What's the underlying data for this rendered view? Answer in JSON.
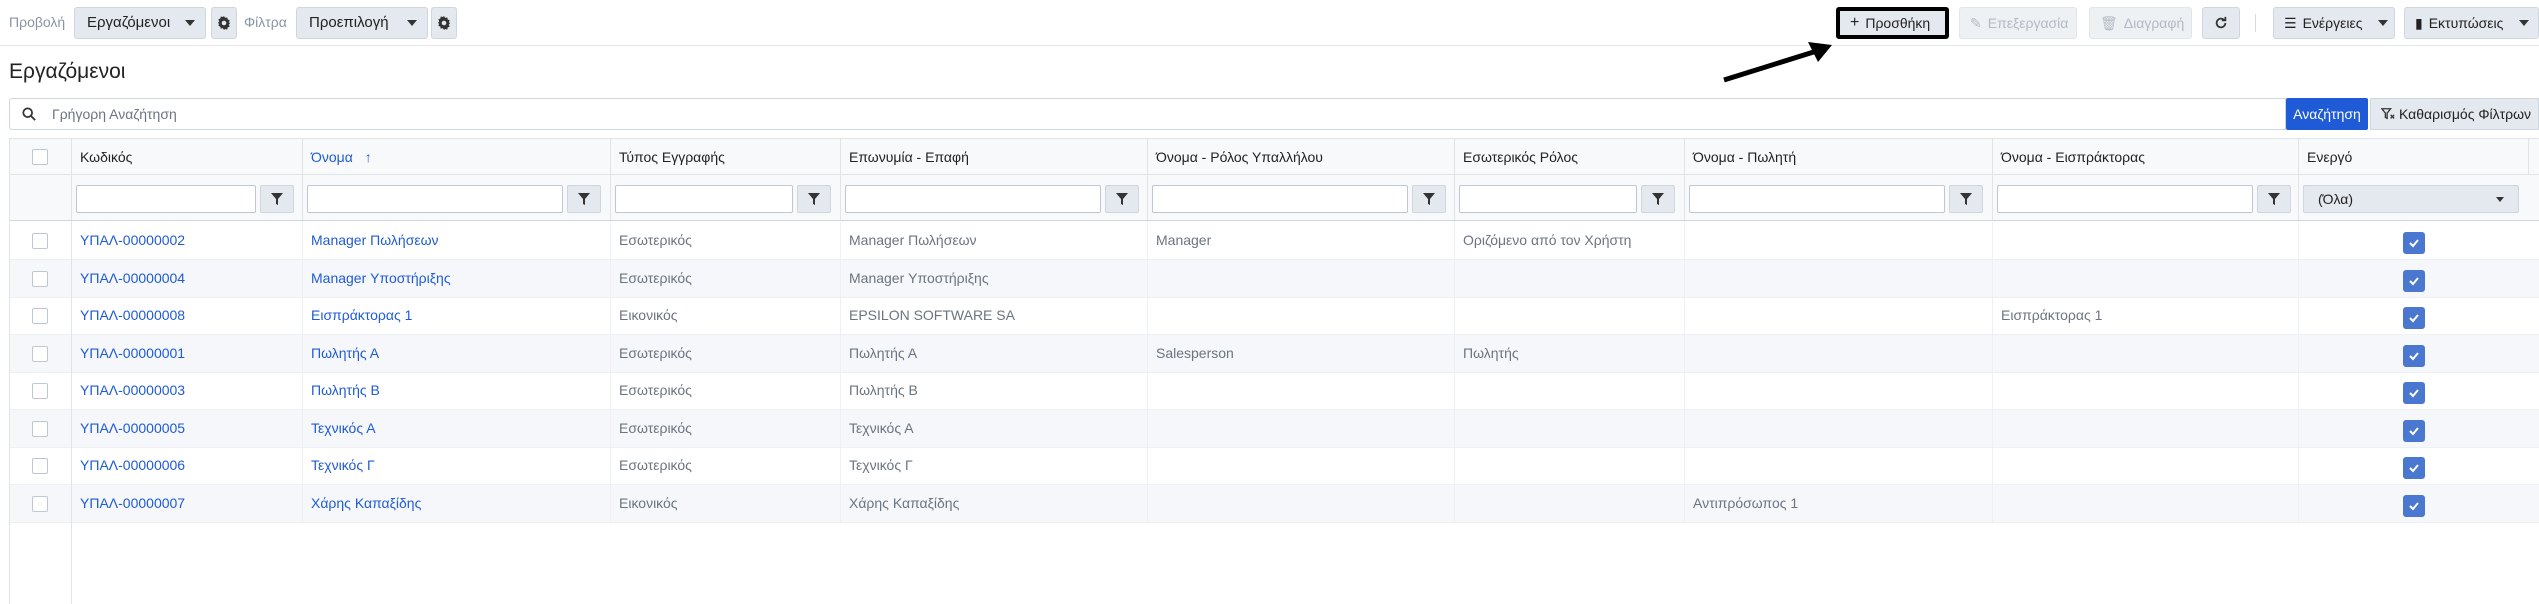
{
  "toolbar": {
    "view_label": "Προβολή",
    "view_value": "Εργαζόμενοι",
    "filter_label": "Φίλτρα",
    "filter_value": "Προεπιλογή",
    "add_label": "Προσθήκη",
    "edit_label": "Επεξεργασία",
    "delete_label": "Διαγραφή",
    "actions_label": "Ενέργειες",
    "prints_label": "Εκτυπώσεις"
  },
  "page_title": "Εργαζόμενοι",
  "search": {
    "placeholder": "Γρήγορη Αναζήτηση",
    "search_button": "Αναζήτηση",
    "clear_button": "Καθαρισμός Φίλτρων"
  },
  "columns": [
    {
      "label": "Κωδικός"
    },
    {
      "label": "Όνομα",
      "sorted": "asc"
    },
    {
      "label": "Τύπος Εγγραφής"
    },
    {
      "label": "Επωνυμία - Επαφή"
    },
    {
      "label": "Όνομα - Ρόλος Υπαλλήλου"
    },
    {
      "label": "Εσωτερικός Ρόλος"
    },
    {
      "label": "Όνομα - Πωλητή"
    },
    {
      "label": "Όνομα - Εισπράκτορας"
    },
    {
      "label": "Ενεργό"
    }
  ],
  "active_filter_value": "(Όλα)",
  "rows": [
    {
      "code": "ΥΠΑΛ-00000002",
      "name": "Manager Πωλήσεων",
      "type": "Εσωτερικός",
      "contact": "Manager Πωλήσεων",
      "role": "Manager",
      "internal_role": "Οριζόμενο από τον Χρήστη",
      "seller": "",
      "collector": "",
      "active": true
    },
    {
      "code": "ΥΠΑΛ-00000004",
      "name": "Manager Υποστήριξης",
      "type": "Εσωτερικός",
      "contact": "Manager Υποστήριξης",
      "role": "",
      "internal_role": "",
      "seller": "",
      "collector": "",
      "active": true
    },
    {
      "code": "ΥΠΑΛ-00000008",
      "name": "Εισπράκτορας 1",
      "type": "Εικονικός",
      "contact": "EPSILON SOFTWARE SA",
      "role": "",
      "internal_role": "",
      "seller": "",
      "collector": "Εισπράκτορας 1",
      "active": true
    },
    {
      "code": "ΥΠΑΛ-00000001",
      "name": "Πωλητής Α",
      "type": "Εσωτερικός",
      "contact": "Πωλητής Α",
      "role": "Salesperson",
      "internal_role": "Πωλητής",
      "seller": "",
      "collector": "",
      "active": true
    },
    {
      "code": "ΥΠΑΛ-00000003",
      "name": "Πωλητής Β",
      "type": "Εσωτερικός",
      "contact": "Πωλητής Β",
      "role": "",
      "internal_role": "",
      "seller": "",
      "collector": "",
      "active": true
    },
    {
      "code": "ΥΠΑΛ-00000005",
      "name": "Τεχνικός Α",
      "type": "Εσωτερικός",
      "contact": "Τεχνικός Α",
      "role": "",
      "internal_role": "",
      "seller": "",
      "collector": "",
      "active": true
    },
    {
      "code": "ΥΠΑΛ-00000006",
      "name": "Τεχνικός Γ",
      "type": "Εσωτερικός",
      "contact": "Τεχνικός Γ",
      "role": "",
      "internal_role": "",
      "seller": "",
      "collector": "",
      "active": true
    },
    {
      "code": "ΥΠΑΛ-00000007",
      "name": "Χάρης Καπαξίδης",
      "type": "Εικονικός",
      "contact": "Χάρης Καπαξίδης",
      "role": "",
      "internal_role": "",
      "seller": "Αντιπρόσωπος 1",
      "collector": "",
      "active": true
    }
  ],
  "colors": {
    "accent": "#1f5bd6",
    "check": "#4a78d0"
  }
}
